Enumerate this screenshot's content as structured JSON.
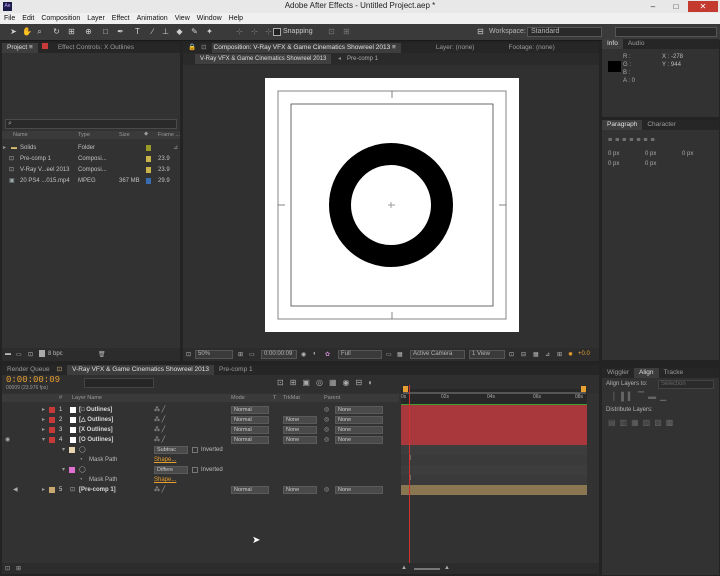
{
  "app": {
    "title": "Adobe After Effects - Untitled Project.aep *",
    "icon_label": "Ae",
    "window_buttons": [
      "–",
      "□",
      "✕"
    ]
  },
  "menu": [
    "File",
    "Edit",
    "Composition",
    "Layer",
    "Effect",
    "Animation",
    "View",
    "Window",
    "Help"
  ],
  "toolbar": {
    "snapping": "Snapping",
    "workspace_label": "Workspace:",
    "workspace_value": "Standard"
  },
  "project": {
    "tabs": [
      "Project ≡",
      "Effect Controls: X Outlines"
    ],
    "columns": [
      "Name",
      "Type",
      "Size",
      "Frame ..."
    ],
    "items": [
      {
        "name": "Solids",
        "type": "Folder",
        "size": "",
        "frame": ""
      },
      {
        "name": "Pre-comp 1",
        "type": "Composi...",
        "size": "",
        "frame": "23.9"
      },
      {
        "name": "V-Ray V...eel 2013",
        "type": "Composi...",
        "size": "",
        "frame": "23.9"
      },
      {
        "name": "20 PS4 ...015.mp4",
        "type": "MPEG",
        "size": "367 MB",
        "frame": "29.9"
      }
    ],
    "bpc": "8 bpc",
    "label_colors": [
      "#9b9b2a",
      "#c9b34a",
      "#c9b34a",
      "#3a6db0"
    ]
  },
  "composition": {
    "tabs": [
      "Composition: V-Ray VFX & Game Cinematics Showreel 2013 ≡",
      "Layer: (none)",
      "Footage: (none)"
    ],
    "subtabs": [
      "V-Ray VFX & Game Cinematics Showreel 2013",
      "Pre-comp 1"
    ],
    "zoom": "50%",
    "timecode": "0:00:00:09",
    "resolution": "Full",
    "camera": "Active Camera",
    "view": "1 View",
    "exposure": "+0.0"
  },
  "info": {
    "tabs": [
      "Info",
      "Audio"
    ],
    "labels": [
      "R :",
      "G :",
      "B :",
      "A : 0"
    ],
    "x": "X : -278",
    "y": "Y : 944"
  },
  "paragraph": {
    "tabs": [
      "Paragraph",
      "Character"
    ],
    "values": [
      "0 px",
      "0 px",
      "0 px",
      "0 px",
      "0 px"
    ]
  },
  "align": {
    "tabs": [
      "Wiggler",
      "Align",
      "Tracke"
    ],
    "align_layers_to": "Align Layers to:",
    "selection": "Selection",
    "distribute": "Distribute Layers:"
  },
  "timeline": {
    "tabs": [
      "Render Queue",
      "V-Ray VFX & Game Cinematics Showreel 2013",
      "Pre-comp 1"
    ],
    "timecode": "0:00:00:09",
    "frame_info": "00009 (23.976 fps)",
    "columns": [
      "#",
      "Layer Name",
      "Mode",
      "T",
      "TrkMat",
      "Parent"
    ],
    "ruler_labels": [
      "0s",
      "02s",
      "04s",
      "06s",
      "08s"
    ],
    "layers": [
      {
        "num": "1",
        "name": "[□ Outlines]",
        "mode": "Normal",
        "trkmat": "",
        "parent": "None",
        "color": "#c83a3a"
      },
      {
        "num": "2",
        "name": "[△ Outlines]",
        "mode": "Normal",
        "trkmat": "None",
        "parent": "None",
        "color": "#c83a3a"
      },
      {
        "num": "3",
        "name": "[X Outlines]",
        "mode": "Normal",
        "trkmat": "None",
        "parent": "None",
        "color": "#c83a3a"
      },
      {
        "num": "4",
        "name": "[O Outlines]",
        "mode": "Normal",
        "trkmat": "None",
        "parent": "None",
        "color": "#c83a3a"
      }
    ],
    "masks": [
      {
        "mode": "Subtrac",
        "inverted": "Inverted",
        "path_label": "Mask Path",
        "path_value": "Shape...",
        "color": "#e8d4b0"
      },
      {
        "mode": "Differe",
        "inverted": "Inverted",
        "path_label": "Mask Path",
        "path_value": "Shape...",
        "color": "#e070d0"
      }
    ],
    "precomp": {
      "num": "5",
      "name": "[Pre-comp 1]",
      "mode": "Normal",
      "trkmat": "None",
      "parent": "None",
      "color": "#c8a870"
    }
  }
}
